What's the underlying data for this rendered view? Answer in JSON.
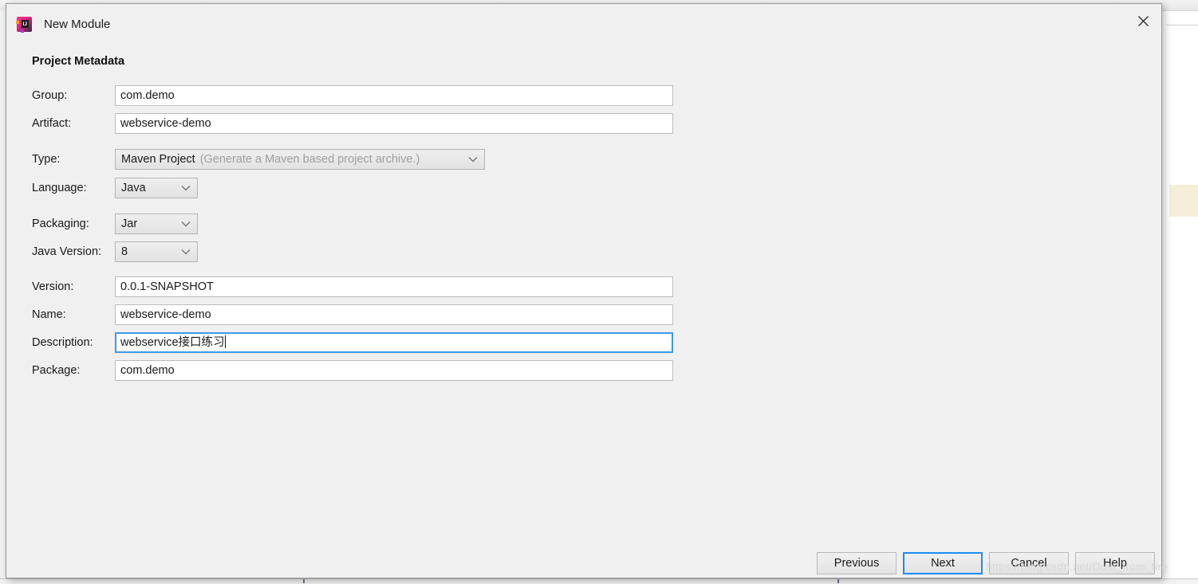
{
  "window": {
    "title": "New Module",
    "app_icon": "intellij-idea-icon",
    "close_icon": "close-icon"
  },
  "section": {
    "heading": "Project Metadata"
  },
  "form": {
    "fields": [
      {
        "label": "Group:",
        "value": "com.demo",
        "kind": "text",
        "focused": false
      },
      {
        "label": "Artifact:",
        "value": "webservice-demo",
        "kind": "text",
        "focused": false
      },
      {
        "label": "Type:",
        "value": "Maven Project",
        "hint": "(Generate a Maven based project archive.)",
        "kind": "combo"
      },
      {
        "label": "Language:",
        "value": "Java",
        "kind": "combo"
      },
      {
        "label": "Packaging:",
        "value": "Jar",
        "kind": "combo"
      },
      {
        "label": "Java Version:",
        "value": "8",
        "kind": "combo"
      },
      {
        "label": "Version:",
        "value": "0.0.1-SNAPSHOT",
        "kind": "text",
        "focused": false
      },
      {
        "label": "Name:",
        "value": "webservice-demo",
        "kind": "text",
        "focused": false
      },
      {
        "label": "Description:",
        "value": "webservice接口练习",
        "kind": "text",
        "focused": true
      },
      {
        "label": "Package:",
        "value": "com.demo",
        "kind": "text",
        "focused": false
      }
    ]
  },
  "buttons": {
    "previous": "Previous",
    "next": "Next",
    "cancel": "Cancel",
    "help": "Help"
  },
  "overlay": {
    "watermark": "https://blog.csdn.net/Dust_from_fire"
  },
  "colors": {
    "focus_blue": "#3d9ae8",
    "default_button_blue": "#1a8cff",
    "dialog_bg": "#f0f0f0",
    "field_bg": "#ffffff",
    "hint_grey": "#a0a0a0",
    "editor_highlight": "#f5eed8"
  }
}
